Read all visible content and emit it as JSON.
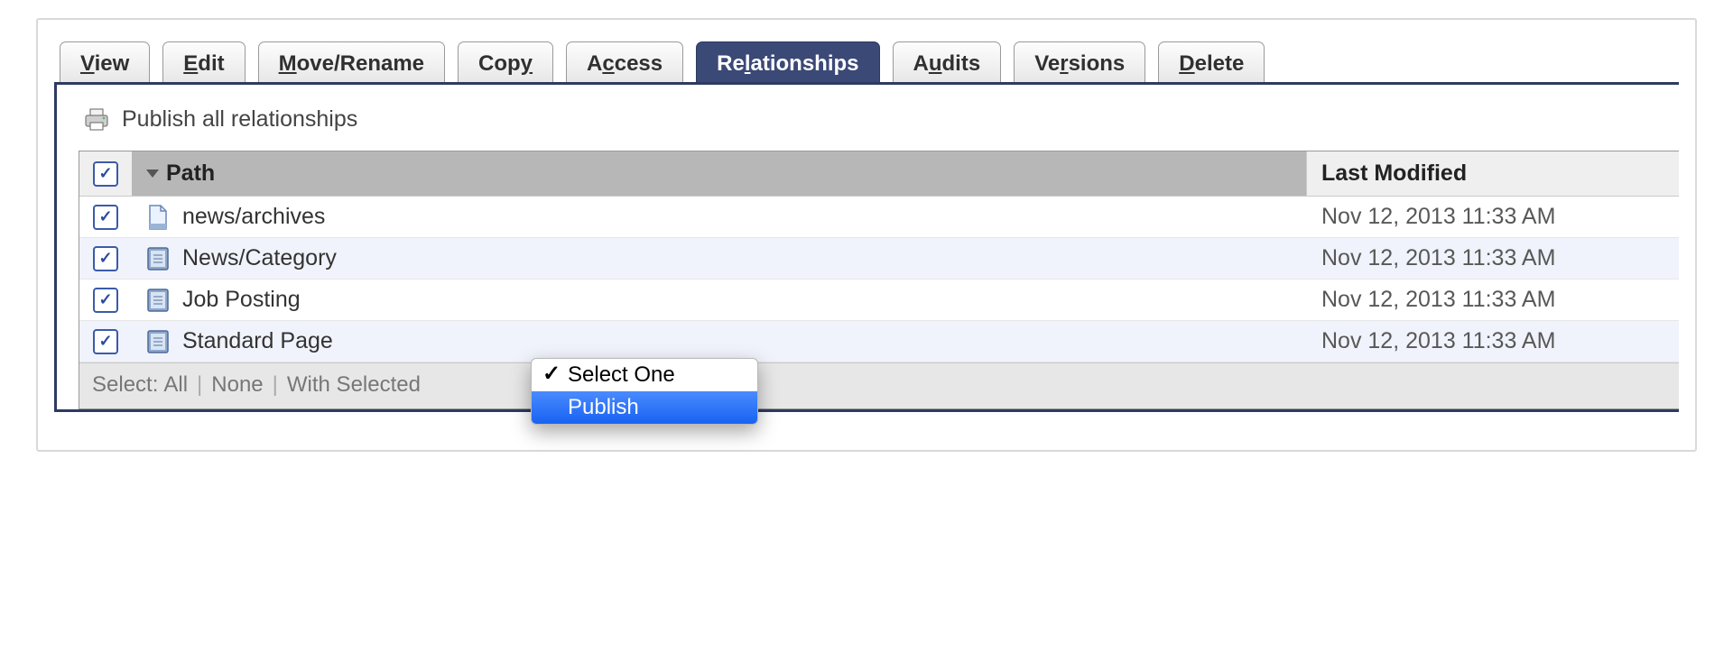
{
  "tabs": [
    {
      "pre": "",
      "u": "V",
      "post": "iew",
      "active": false
    },
    {
      "pre": "",
      "u": "E",
      "post": "dit",
      "active": false
    },
    {
      "pre": "",
      "u": "M",
      "post": "ove/Rename",
      "active": false
    },
    {
      "pre": "Cop",
      "u": "y",
      "post": "",
      "active": false
    },
    {
      "pre": "A",
      "u": "c",
      "post": "cess",
      "active": false
    },
    {
      "pre": "Re",
      "u": "l",
      "post": "ationships",
      "active": true
    },
    {
      "pre": "A",
      "u": "u",
      "post": "dits",
      "active": false
    },
    {
      "pre": "Ve",
      "u": "r",
      "post": "sions",
      "active": false
    },
    {
      "pre": "",
      "u": "D",
      "post": "elete",
      "active": false
    }
  ],
  "publish_all_label": "Publish all relationships",
  "grid": {
    "headers": {
      "path": "Path",
      "modified": "Last Modified"
    },
    "select_all_checked": true,
    "rows": [
      {
        "checked": true,
        "icon": "file",
        "path": "news/archives",
        "modified": "Nov 12, 2013 11:33 AM",
        "alt": false
      },
      {
        "checked": true,
        "icon": "folder",
        "path": "News/Category",
        "modified": "Nov 12, 2013 11:33 AM",
        "alt": true
      },
      {
        "checked": true,
        "icon": "folder",
        "path": "Job Posting",
        "modified": "Nov 12, 2013 11:33 AM",
        "alt": false
      },
      {
        "checked": true,
        "icon": "folder",
        "path": "Standard Page",
        "modified": "Nov 12, 2013 11:33 AM",
        "alt": true
      }
    ]
  },
  "footer": {
    "select_label": "Select:",
    "all": "All",
    "none": "None",
    "with_selected": "With Selected",
    "dropdown": {
      "selected": "Select One",
      "highlighted": "Publish"
    }
  }
}
